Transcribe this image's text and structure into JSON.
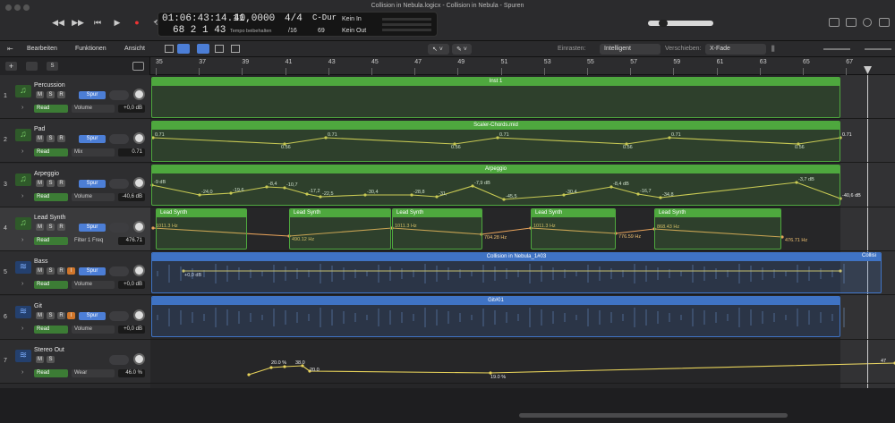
{
  "window": {
    "title": "Collision in Nebula.logicx - Collision in Nebula - Spuren"
  },
  "lcd": {
    "time": "01:06:43:14.11",
    "bars": "68  2  1   43",
    "tempo": "40,0000",
    "tempo_label": "Tempo beibehalten",
    "signature": "4/4",
    "division": "/16",
    "key": "C-Dur",
    "key_value": "69",
    "in_label": "Kein In",
    "out_label": "Kein Out"
  },
  "menus": {
    "edit": "Bearbeiten",
    "functions": "Funktionen",
    "view": "Ansicht"
  },
  "snap": {
    "label": "Einrasten:",
    "value": "Intelligent"
  },
  "drag": {
    "label": "Verschieben:",
    "value": "X-Fade"
  },
  "ruler": {
    "bars": [
      "35",
      "37",
      "39",
      "41",
      "43",
      "45",
      "47",
      "49",
      "51",
      "53",
      "55",
      "57",
      "59",
      "61",
      "63",
      "65",
      "67"
    ]
  },
  "colors": {
    "green_region": "#4ea83e",
    "blue_region": "#3f73c4",
    "automation": "#e8d35a"
  },
  "common": {
    "mute": "M",
    "solo": "S",
    "rec": "R",
    "input": "I",
    "track_button": "Spur",
    "read": "Read"
  },
  "tracks": [
    {
      "num": "1",
      "name": "Percussion",
      "icon": "music-note-icon",
      "param": "Volume",
      "value": "+0,0 dB",
      "rec": true
    },
    {
      "num": "2",
      "name": "Pad",
      "icon": "music-note-icon",
      "param": "Mix",
      "value": "0.71",
      "rec": true
    },
    {
      "num": "3",
      "name": "Arpeggio",
      "icon": "music-note-icon",
      "param": "Volume",
      "value": "-40,6 dB",
      "rec": true
    },
    {
      "num": "4",
      "name": "Lead Synth",
      "icon": "music-note-icon",
      "param": "Filter 1 Freq",
      "value": "476.71",
      "rec": true
    },
    {
      "num": "5",
      "name": "Bass",
      "icon": "waveform-icon",
      "param": "Volume",
      "value": "+0,0 dB",
      "input": true
    },
    {
      "num": "6",
      "name": "Git",
      "icon": "waveform-icon",
      "param": "Volume",
      "value": "+0,0 dB",
      "input": true
    },
    {
      "num": "7",
      "name": "Stereo Out",
      "icon": "waveform-icon",
      "param": "Wear",
      "value": "46.0 %",
      "stereo": true
    }
  ],
  "regions": {
    "inst1": "Inst 1",
    "scaler": "Scaler-Chords.mid",
    "arpeggio": "Arpeggio",
    "lead": "Lead Synth",
    "bass": "Collision in Nebula_1#03",
    "bass_end": "Collisi",
    "git": "Git#01"
  },
  "automation": {
    "pad": [
      "0.71",
      "0.56",
      "0.71",
      "0.56",
      "0.71",
      "0.56",
      "0.71",
      "0.56",
      "0.71"
    ],
    "arp": [
      "-9 dB",
      "-24,0",
      "-19,6",
      "-8,4",
      "-10,7",
      "-17,2",
      "-22,5",
      "-30,4",
      "-28,8",
      "-31,",
      "-7,9 dB",
      "-45,5",
      "-30,4",
      "-8,4 dB",
      "-16,7",
      "-34,8",
      "-3,7 dB",
      "-40,6 dB"
    ],
    "lead": [
      "1011.3 Hz",
      "490.12 Hz",
      "1011.3 Hz",
      "704.28 Hz",
      "1011.3 Hz",
      "776.59 Hz",
      "868.43 Hz",
      "476.71 Hz"
    ],
    "bass": "+0,0 dB",
    "stereo": [
      "20.0 %",
      "38.0",
      "20.0",
      "19.0 %",
      "47"
    ]
  }
}
